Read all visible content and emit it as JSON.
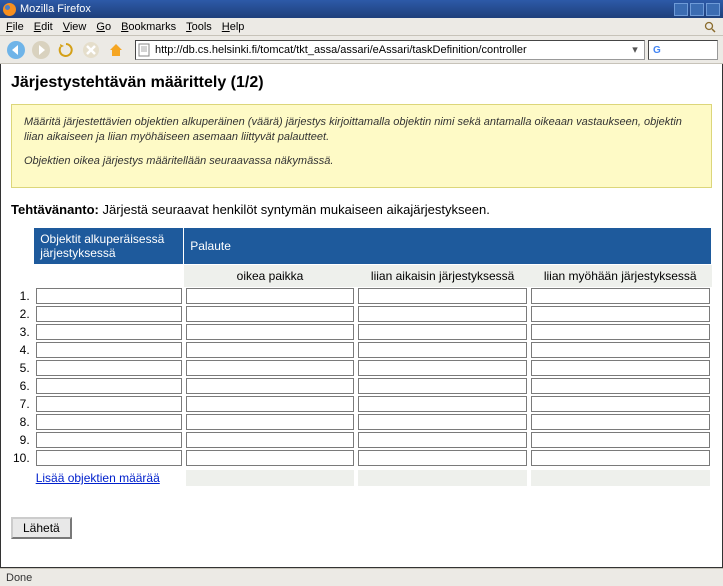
{
  "window": {
    "title": "Mozilla Firefox"
  },
  "menu": {
    "file": "File",
    "edit": "Edit",
    "view": "View",
    "go": "Go",
    "bookmarks": "Bookmarks",
    "tools": "Tools",
    "help": "Help"
  },
  "toolbar": {
    "url": "http://db.cs.helsinki.fi/tomcat/tkt_assa/assari/eAssari/taskDefinition/controller"
  },
  "page": {
    "title": "Järjestystehtävän määrittely (1/2)",
    "notice_p1": "Määritä järjestettävien objektien alkuperäinen (väärä) järjestys kirjoittamalla objektin nimi sekä antamalla oikeaan vastaukseen, objektin liian aikaiseen ja liian myöhäiseen asemaan liittyvät palautteet.",
    "notice_p2": "Objektien oikea järjestys määritellään seuraavassa näkymässä.",
    "task_label": "Tehtävänanto:",
    "task_text": "Järjestä seuraavat henkilöt syntymän mukaiseen aikajärjestykseen."
  },
  "table": {
    "col_objects": "Objektit alkuperäisessä järjestyksessä",
    "col_feedback": "Palaute",
    "sub_correct": "oikea paikka",
    "sub_early": "liian aikaisin järjestyksessä",
    "sub_late": "liian myöhään järjestyksessä",
    "rows": [
      "1.",
      "2.",
      "3.",
      "4.",
      "5.",
      "6.",
      "7.",
      "8.",
      "9.",
      "10."
    ],
    "add_more": "Lisää objektien määrää"
  },
  "buttons": {
    "submit": "Lähetä"
  },
  "status": {
    "text": "Done"
  }
}
